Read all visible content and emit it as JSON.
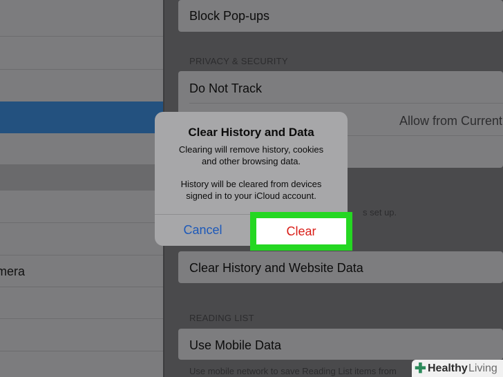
{
  "settings": {
    "block_popups": "Block Pop-ups",
    "privacy_header": "PRIVACY & SECURITY",
    "do_not_track": "Do Not Track",
    "cookies_value": "Allow from Current",
    "note_partial": "s set up.",
    "clear_history": "Clear History and Website Data",
    "reading_list_header": "READING LIST",
    "use_mobile_data": "Use Mobile Data",
    "reading_note": "Use mobile network to save Reading List items from"
  },
  "sidebar": {
    "camera_label": "mera"
  },
  "dialog": {
    "title": "Clear History and Data",
    "line1": "Clearing will remove history, cookies",
    "line2": "and other browsing data.",
    "line3": "History will be cleared from devices",
    "line4": "signed in to your iCloud account.",
    "cancel": "Cancel",
    "clear": "Clear"
  },
  "watermark": {
    "healthy": "Healthy",
    "living": "Living"
  },
  "colors": {
    "highlight": "#25d722",
    "destructive": "#d91d17",
    "link": "#1d59b9"
  }
}
